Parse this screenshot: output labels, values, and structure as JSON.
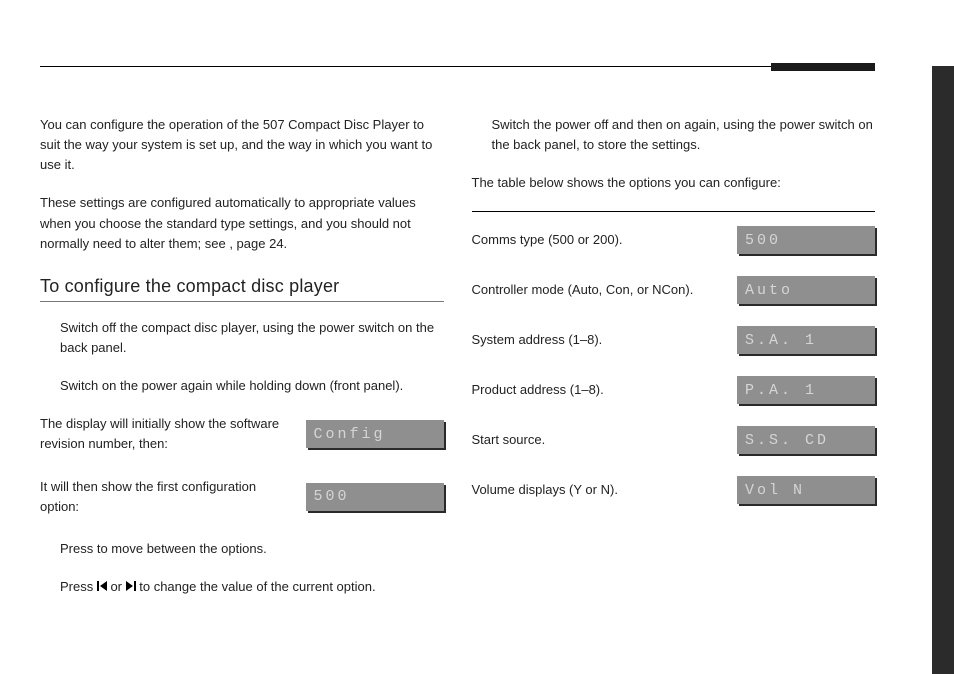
{
  "left": {
    "intro1": "You can configure the operation of the 507 Compact Disc Player to suit the way your system is set up, and the way in which you want to use it.",
    "intro2_a": "These settings are configured automatically to appropriate values when you choose the standard type settings, and you should not normally need to alter them; see ",
    "intro2_b": ", page 24.",
    "heading": "To configure the compact disc player",
    "step1": "Switch off the compact disc player, using the power switch on the back panel.",
    "step2_a": "Switch on the power again while holding down ",
    "step2_b": " (front panel).",
    "row1_text": "The display will initially show the software revision number, then:",
    "row1_lcd": "Config",
    "row2_text": "It will then show the first configuration option:",
    "row2_lcd": "500",
    "press_a": "Press ",
    "press_b": " to move between the options.",
    "change_a": "Press ",
    "change_b": " or ",
    "change_c": " to change the value of the current option."
  },
  "right": {
    "store": "Switch the power off and then on again, using the power switch on the back panel, to store the settings.",
    "table_intro": "The table below shows the options you can configure:",
    "options": [
      {
        "label": "Comms type (500 or 200).",
        "lcd": "500"
      },
      {
        "label": "Controller mode (Auto, Con, or NCon).",
        "lcd": "Auto"
      },
      {
        "label": "System address (1–8).",
        "lcd": "S.A. 1"
      },
      {
        "label": "Product address (1–8).",
        "lcd": "P.A. 1"
      },
      {
        "label": "Start source.",
        "lcd": "S.S. CD"
      },
      {
        "label": "Volume displays (Y or N).",
        "lcd": "Vol N"
      }
    ]
  }
}
